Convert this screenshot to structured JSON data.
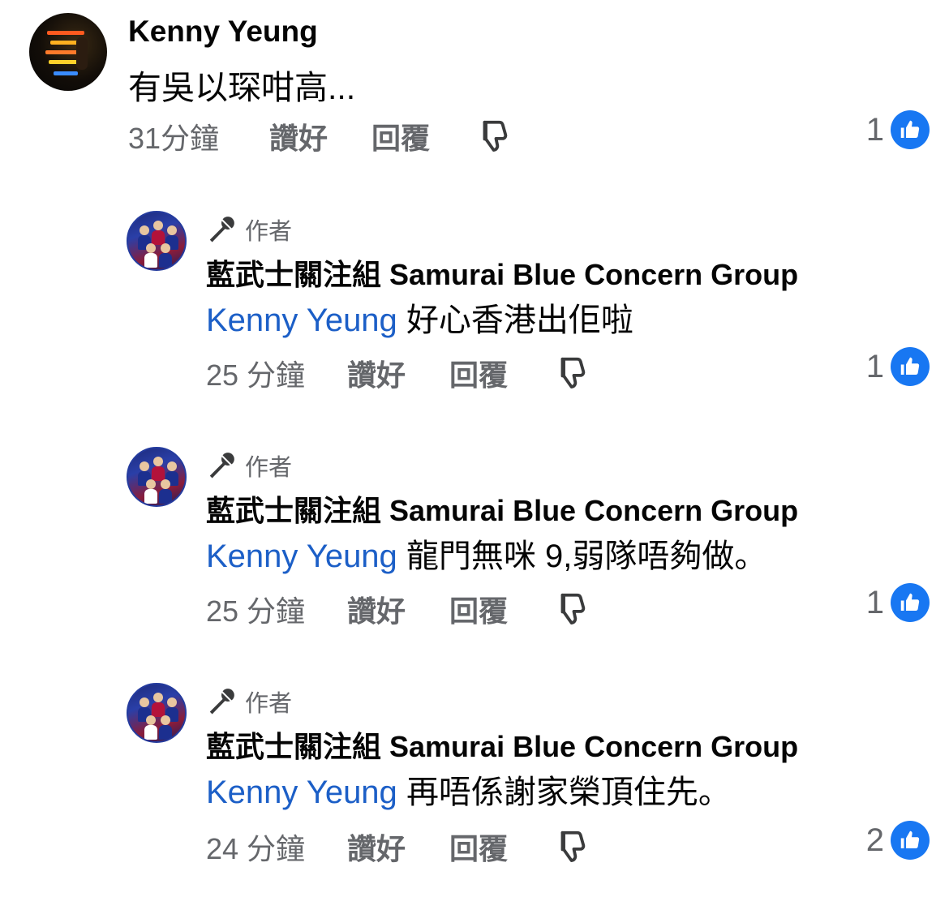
{
  "comments": [
    {
      "author": "Kenny Yeung",
      "text": "有吳以琛咁高...",
      "time": "31分鐘",
      "like_label": "讚好",
      "reply_label": "回覆",
      "reaction_count": "1"
    },
    {
      "author_badge": "作者",
      "author": "藍武士關注組 Samurai Blue Concern Group",
      "mention": "Kenny Yeung",
      "text": "好心香港出佢啦",
      "time": "25 分鐘",
      "like_label": "讚好",
      "reply_label": "回覆",
      "reaction_count": "1"
    },
    {
      "author_badge": "作者",
      "author": "藍武士關注組 Samurai Blue Concern Group",
      "mention": "Kenny Yeung",
      "text": "龍門無咪 9,弱隊唔夠做。",
      "time": "25 分鐘",
      "like_label": "讚好",
      "reply_label": "回覆",
      "reaction_count": "1"
    },
    {
      "author_badge": "作者",
      "author": "藍武士關注組 Samurai Blue Concern Group",
      "mention": "Kenny Yeung",
      "text": "再唔係謝家榮頂住先。",
      "time": "24 分鐘",
      "like_label": "讚好",
      "reply_label": "回覆",
      "reaction_count": "2"
    }
  ],
  "icons": {
    "author_badge": "microphone-icon",
    "dislike": "thumbs-down-icon",
    "reaction": "thumbs-up-icon"
  },
  "colors": {
    "mention": "#1c5fc7",
    "like_badge": "#1877f2",
    "secondary_text": "#65676b"
  }
}
